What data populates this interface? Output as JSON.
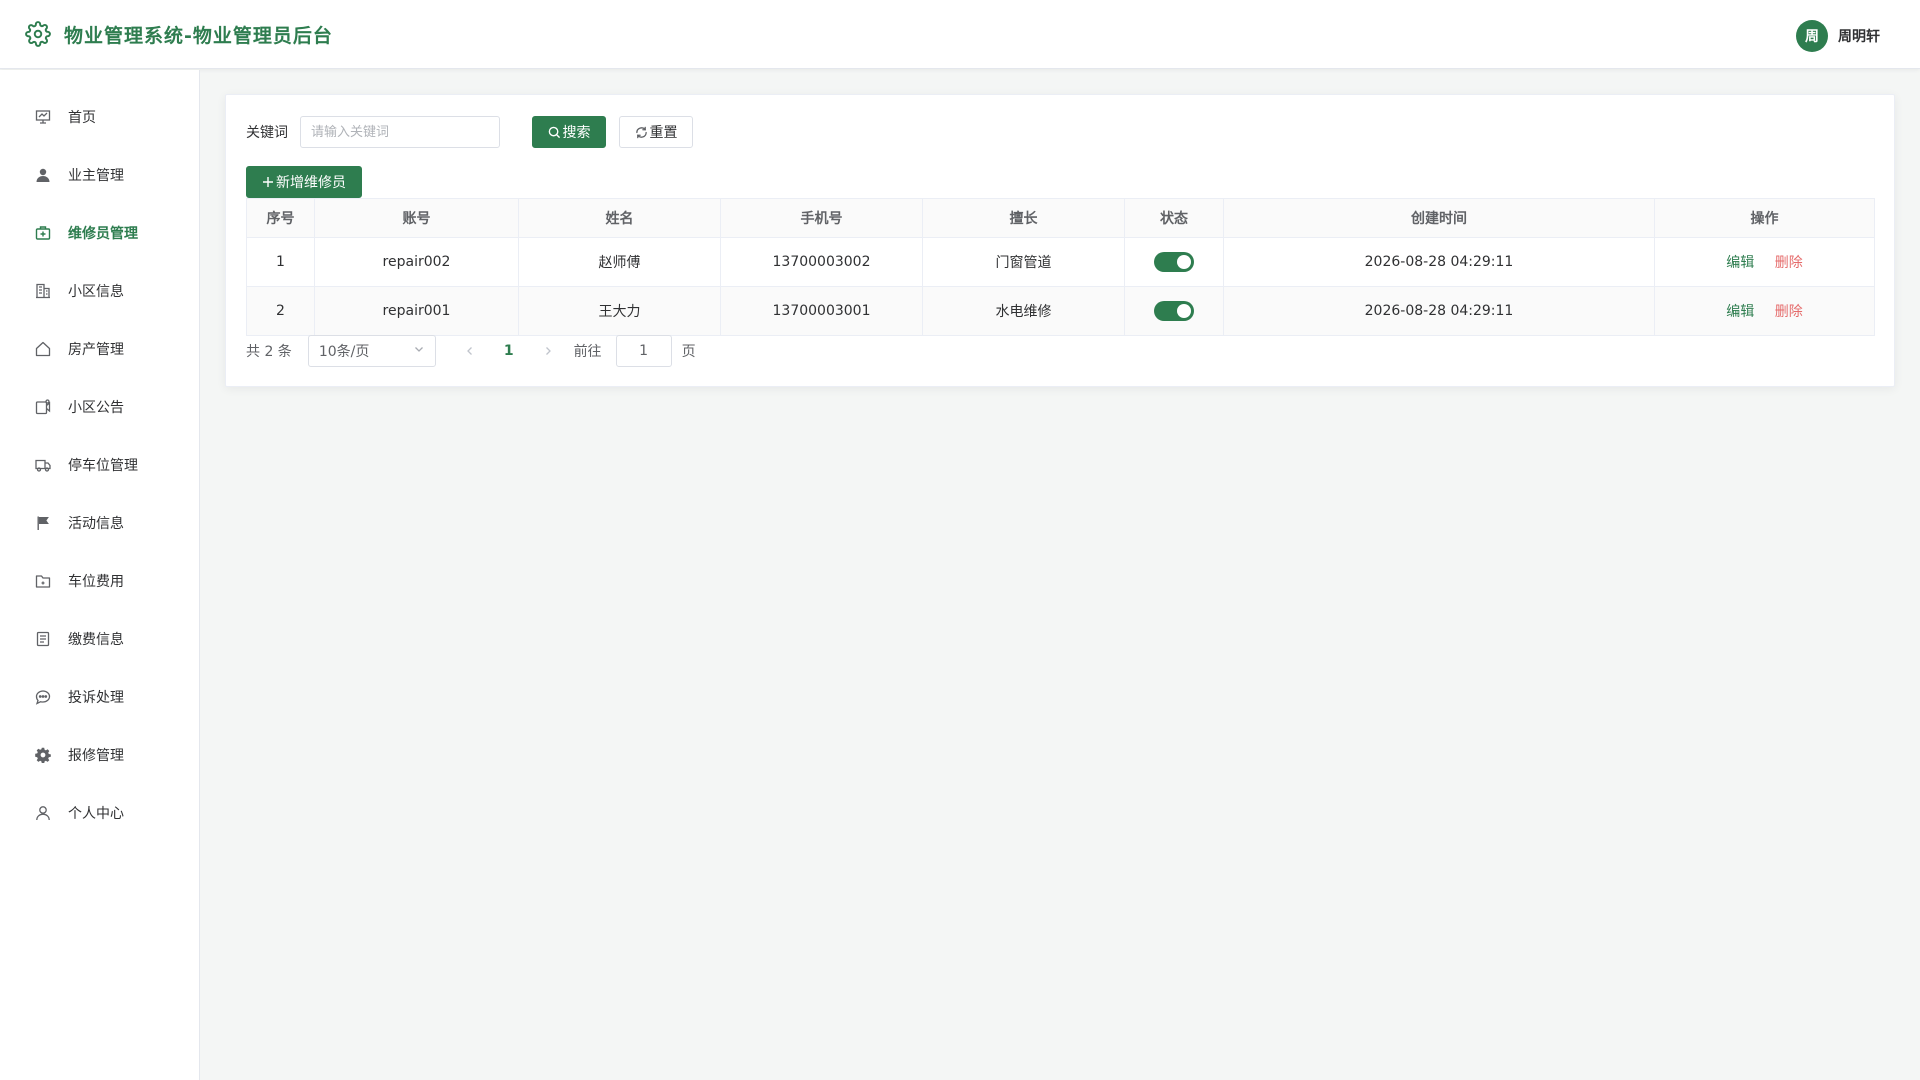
{
  "app": {
    "title": "物业管理系统-物业管理员后台"
  },
  "user": {
    "avatar_text": "周",
    "name": "周明轩"
  },
  "colors": {
    "primary": "#2e7d4f",
    "danger": "#e56b6b"
  },
  "sidebar": {
    "items": [
      {
        "label": "首页",
        "icon": "presentation-chart-icon",
        "active": false
      },
      {
        "label": "业主管理",
        "icon": "user-icon",
        "active": false
      },
      {
        "label": "维修员管理",
        "icon": "first-aid-kit-icon",
        "active": true
      },
      {
        "label": "小区信息",
        "icon": "office-building-icon",
        "active": false
      },
      {
        "label": "房产管理",
        "icon": "house-icon",
        "active": false
      },
      {
        "label": "小区公告",
        "icon": "notice-icon",
        "active": false
      },
      {
        "label": "停车位管理",
        "icon": "van-icon",
        "active": false
      },
      {
        "label": "活动信息",
        "icon": "flag-icon",
        "active": false
      },
      {
        "label": "车位费用",
        "icon": "folder-icon",
        "active": false
      },
      {
        "label": "缴费信息",
        "icon": "document-icon",
        "active": false
      },
      {
        "label": "投诉处理",
        "icon": "chat-bubble-icon",
        "active": false
      },
      {
        "label": "报修管理",
        "icon": "gear-icon",
        "active": false
      },
      {
        "label": "个人中心",
        "icon": "user-outline-icon",
        "active": false
      }
    ]
  },
  "search": {
    "label": "关键词",
    "placeholder": "请输入关键词",
    "value": "",
    "search_label": "搜索",
    "reset_label": "重置"
  },
  "toolbar": {
    "add_label": "新增维修员"
  },
  "table": {
    "columns": [
      "序号",
      "账号",
      "姓名",
      "手机号",
      "擅长",
      "状态",
      "创建时间",
      "操作"
    ],
    "rows": [
      {
        "index": "1",
        "account": "repair002",
        "name": "赵师傅",
        "phone": "13700003002",
        "specialty": "门窗管道",
        "status_on": true,
        "created": "2026-08-28 04:29:11"
      },
      {
        "index": "2",
        "account": "repair001",
        "name": "王大力",
        "phone": "13700003001",
        "specialty": "水电维修",
        "status_on": true,
        "created": "2026-08-28 04:29:11"
      }
    ],
    "edit_label": "编辑",
    "delete_label": "删除"
  },
  "pagination": {
    "total_text": "共 2 条",
    "page_size": "10条/页",
    "current_page": "1",
    "goto_label": "前往",
    "goto_value": "1",
    "page_suffix": "页"
  }
}
